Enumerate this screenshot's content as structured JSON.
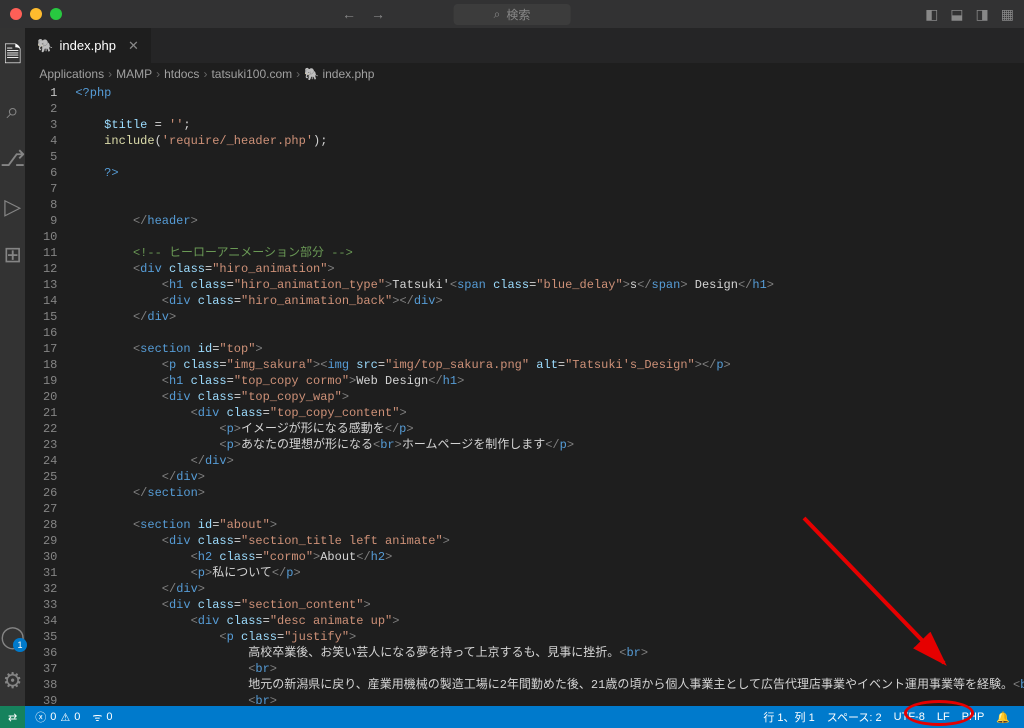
{
  "search_placeholder": "検索",
  "tab": {
    "icon": "🐘",
    "label": "index.php"
  },
  "breadcrumbs": [
    "Applications",
    "MAMP",
    "htdocs",
    "tatsuki100.com",
    "index.php"
  ],
  "account_badge": "1",
  "statusbar": {
    "errors": "0",
    "warnings": "0",
    "ports": "0",
    "cursor": "行 1、列 1",
    "spaces": "スペース: 2",
    "encoding": "UTF-8",
    "eol": "LF",
    "lang": "PHP"
  },
  "code_lines": [
    {
      "n": 1,
      "t": "php_open",
      "raw": "<?php"
    },
    {
      "n": 2,
      "t": "blank",
      "raw": ""
    },
    {
      "n": 3,
      "t": "php_assign",
      "indent": 1,
      "var": "$title",
      "val": "''"
    },
    {
      "n": 4,
      "t": "php_call",
      "indent": 1,
      "fn": "include",
      "arg": "'require/_header.php'"
    },
    {
      "n": 5,
      "t": "blank",
      "raw": ""
    },
    {
      "n": 6,
      "t": "php_close",
      "indent": 1,
      "raw": "?>"
    },
    {
      "n": 7,
      "t": "blank",
      "raw": ""
    },
    {
      "n": 8,
      "t": "blank",
      "raw": ""
    },
    {
      "n": 9,
      "t": "close_tag",
      "indent": 2,
      "tag": "header"
    },
    {
      "n": 10,
      "t": "blank",
      "raw": ""
    },
    {
      "n": 11,
      "t": "comment",
      "indent": 2,
      "text": "<!-- ヒーローアニメーション部分 -->"
    },
    {
      "n": 12,
      "t": "open_tag",
      "indent": 2,
      "tag": "div",
      "attrs": [
        [
          "class",
          "hiro_animation"
        ]
      ]
    },
    {
      "n": 13,
      "t": "h1_special",
      "indent": 3
    },
    {
      "n": 14,
      "t": "open_close",
      "indent": 3,
      "tag": "div",
      "attrs": [
        [
          "class",
          "hiro_animation_back"
        ]
      ]
    },
    {
      "n": 15,
      "t": "close_tag",
      "indent": 2,
      "tag": "div"
    },
    {
      "n": 16,
      "t": "blank",
      "raw": ""
    },
    {
      "n": 17,
      "t": "open_tag",
      "indent": 2,
      "tag": "section",
      "attrs": [
        [
          "id",
          "top"
        ]
      ]
    },
    {
      "n": 18,
      "t": "img_line",
      "indent": 3
    },
    {
      "n": 19,
      "t": "el_text",
      "indent": 3,
      "tag": "h1",
      "attrs": [
        [
          "class",
          "top_copy cormo"
        ]
      ],
      "text": "Web Design"
    },
    {
      "n": 20,
      "t": "open_tag",
      "indent": 3,
      "tag": "div",
      "attrs": [
        [
          "class",
          "top_copy_wap"
        ]
      ]
    },
    {
      "n": 21,
      "t": "open_tag",
      "indent": 4,
      "tag": "div",
      "attrs": [
        [
          "class",
          "top_copy_content"
        ]
      ]
    },
    {
      "n": 22,
      "t": "el_text",
      "indent": 5,
      "tag": "p",
      "attrs": [],
      "text": "イメージが形になる感動を"
    },
    {
      "n": 23,
      "t": "p_br",
      "indent": 5,
      "pre": "あなたの理想が形になる",
      "post": "ホームページを制作します"
    },
    {
      "n": 24,
      "t": "close_tag",
      "indent": 4,
      "tag": "div"
    },
    {
      "n": 25,
      "t": "close_tag",
      "indent": 3,
      "tag": "div"
    },
    {
      "n": 26,
      "t": "close_tag",
      "indent": 2,
      "tag": "section"
    },
    {
      "n": 27,
      "t": "blank",
      "raw": ""
    },
    {
      "n": 28,
      "t": "open_tag",
      "indent": 2,
      "tag": "section",
      "attrs": [
        [
          "id",
          "about"
        ]
      ]
    },
    {
      "n": 29,
      "t": "open_tag",
      "indent": 3,
      "tag": "div",
      "attrs": [
        [
          "class",
          "section_title left animate"
        ]
      ]
    },
    {
      "n": 30,
      "t": "el_text",
      "indent": 4,
      "tag": "h2",
      "attrs": [
        [
          "class",
          "cormo"
        ]
      ],
      "text": "About"
    },
    {
      "n": 31,
      "t": "el_text",
      "indent": 4,
      "tag": "p",
      "attrs": [],
      "text": "私について"
    },
    {
      "n": 32,
      "t": "close_tag",
      "indent": 3,
      "tag": "div"
    },
    {
      "n": 33,
      "t": "open_tag",
      "indent": 3,
      "tag": "div",
      "attrs": [
        [
          "class",
          "section_content"
        ]
      ]
    },
    {
      "n": 34,
      "t": "open_tag",
      "indent": 4,
      "tag": "div",
      "attrs": [
        [
          "class",
          "desc animate up"
        ]
      ]
    },
    {
      "n": 35,
      "t": "open_tag",
      "indent": 5,
      "tag": "p",
      "attrs": [
        [
          "class",
          "justify"
        ]
      ]
    },
    {
      "n": 36,
      "t": "text_br",
      "indent": 6,
      "text": "高校卒業後、お笑い芸人になる夢を持って上京するも、見事に挫折。"
    },
    {
      "n": 37,
      "t": "br_only",
      "indent": 6
    },
    {
      "n": 38,
      "t": "text_br",
      "indent": 6,
      "text": "地元の新潟県に戻り、産業用機械の製造工場に2年間勤めた後、21歳の頃から個人事業主として広告代理店事業やイベント運用事業等を経験。"
    },
    {
      "n": 39,
      "t": "br_only",
      "indent": 6
    }
  ]
}
